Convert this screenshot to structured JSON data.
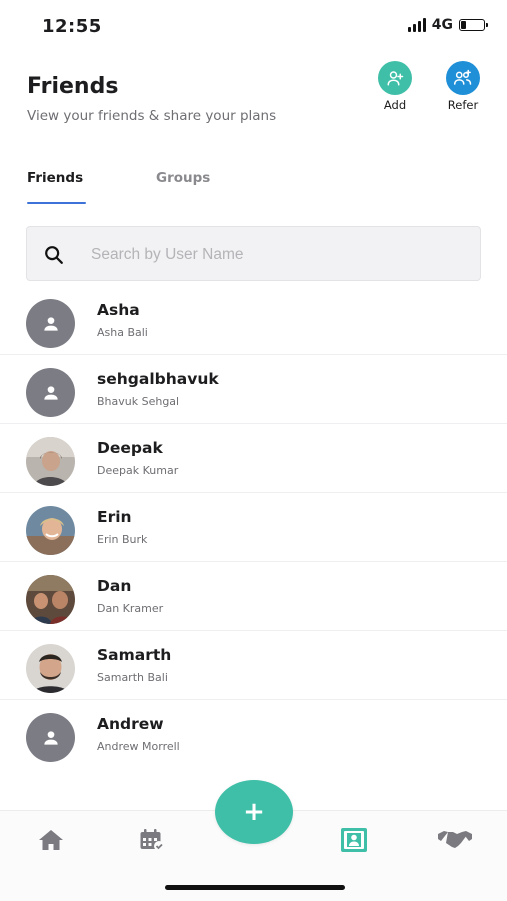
{
  "status": {
    "time": "12:55",
    "network": "4G"
  },
  "header": {
    "title": "Friends",
    "subtitle": "View your friends & share your plans",
    "add_label": "Add",
    "refer_label": "Refer",
    "accent_add": "#3fbfa8",
    "accent_refer": "#1f8fd8"
  },
  "tabs": [
    {
      "label": "Friends",
      "active": true
    },
    {
      "label": "Groups",
      "active": false
    }
  ],
  "search": {
    "placeholder": "Search by User Name",
    "value": ""
  },
  "friends": [
    {
      "name": "Asha",
      "full_name": "Asha Bali",
      "avatar": "default-person-icon"
    },
    {
      "name": "sehgalbhavuk",
      "full_name": "Bhavuk Sehgal",
      "avatar": "default-person-icon"
    },
    {
      "name": "Deepak",
      "full_name": "Deepak Kumar",
      "avatar": "photo"
    },
    {
      "name": "Erin",
      "full_name": "Erin Burk",
      "avatar": "photo"
    },
    {
      "name": "Dan",
      "full_name": "Dan Kramer",
      "avatar": "photo"
    },
    {
      "name": "Samarth",
      "full_name": "Samarth Bali",
      "avatar": "photo"
    },
    {
      "name": "Andrew",
      "full_name": "Andrew Morrell",
      "avatar": "default-person-icon"
    }
  ],
  "bottom_nav": {
    "items": [
      "home-icon",
      "calendar-icon",
      "add-icon",
      "friends-contact-icon",
      "handshake-icon"
    ],
    "active": "friends-contact-icon",
    "active_color": "#3fbfa8"
  }
}
